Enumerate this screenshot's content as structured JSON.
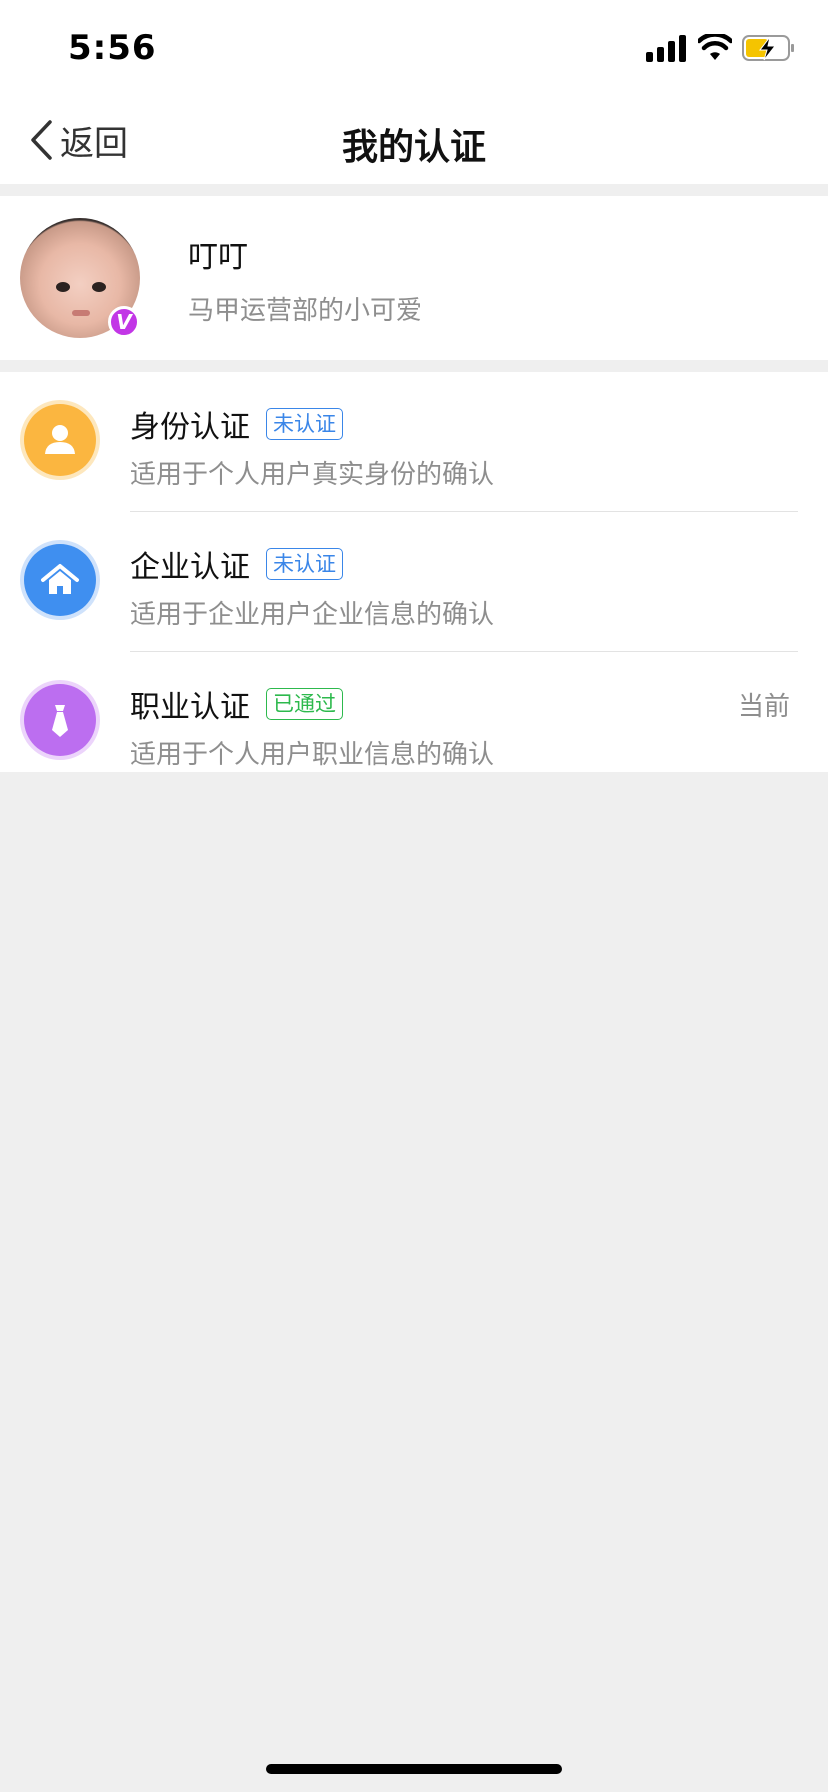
{
  "status_bar": {
    "time": "5:56"
  },
  "nav": {
    "back_label": "返回",
    "title": "我的认证"
  },
  "profile": {
    "name": "叮叮",
    "description": "马甲运营部的小可爱",
    "verified_mark": "V"
  },
  "certifications": [
    {
      "title": "身份认证",
      "tag": "未认证",
      "tag_color": "#3a86e8",
      "description": "适用于个人用户真实身份的确认",
      "icon": "person-icon",
      "icon_color": "#fbb640",
      "current_label": ""
    },
    {
      "title": "企业认证",
      "tag": "未认证",
      "tag_color": "#3a86e8",
      "description": "适用于企业用户企业信息的确认",
      "icon": "home-icon",
      "icon_color": "#3f8ff0",
      "current_label": ""
    },
    {
      "title": "职业认证",
      "tag": "已通过",
      "tag_color": "#2db94d",
      "description": "适用于个人用户职业信息的确认",
      "icon": "tie-icon",
      "icon_color": "#bc6ef0",
      "current_label": "当前"
    }
  ],
  "colors": {
    "background": "#efefef",
    "verified_badge": "#c236e6"
  }
}
